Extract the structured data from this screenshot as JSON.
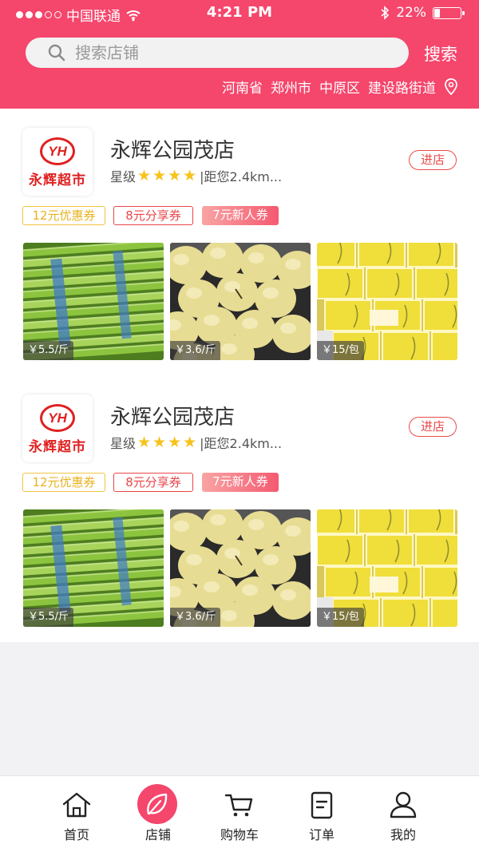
{
  "status_bar": {
    "carrier": "中国联通",
    "time": "4:21 PM",
    "battery": "22%",
    "battery_level": 0.22
  },
  "search": {
    "placeholder": "搜索店铺",
    "button_label": "搜索"
  },
  "location": {
    "province": "河南省",
    "city": "郑州市",
    "district": "中原区",
    "street": "建设路街道"
  },
  "stores": [
    {
      "logo_mark": "YH",
      "logo_text": "永辉超市",
      "name": "永辉公园茂店",
      "rating_label": "星级",
      "stars": 4,
      "distance": "|距您2.4km...",
      "enter_label": "进店",
      "coupons": [
        "12元优惠券",
        "8元分享券",
        "7元新人券"
      ],
      "products": [
        {
          "image": "green-onion-photo",
          "price": "￥5.5/斤"
        },
        {
          "image": "pear-photo",
          "price": "￥3.6/斤"
        },
        {
          "image": "tissue-pack-photo",
          "price": "￥15/包"
        }
      ]
    },
    {
      "logo_mark": "YH",
      "logo_text": "永辉超市",
      "name": "永辉公园茂店",
      "rating_label": "星级",
      "stars": 4,
      "distance": "|距您2.4km...",
      "enter_label": "进店",
      "coupons": [
        "12元优惠券",
        "8元分享券",
        "7元新人券"
      ],
      "products": [
        {
          "image": "green-onion-photo",
          "price": "￥5.5/斤"
        },
        {
          "image": "pear-photo",
          "price": "￥3.6/斤"
        },
        {
          "image": "tissue-pack-photo",
          "price": "￥15/包"
        }
      ]
    }
  ],
  "tabbar": [
    {
      "label": "首页",
      "icon": "home-icon",
      "active": false
    },
    {
      "label": "店铺",
      "icon": "leaf-icon",
      "active": true
    },
    {
      "label": "购物车",
      "icon": "cart-icon",
      "active": false
    },
    {
      "label": "订单",
      "icon": "order-icon",
      "active": false
    },
    {
      "label": "我的",
      "icon": "user-icon",
      "active": false
    }
  ],
  "colors": {
    "brand": "#f5466c",
    "star": "#f7c21a",
    "coupon_yellow": "#e8b21f",
    "coupon_red": "#e9464a"
  }
}
